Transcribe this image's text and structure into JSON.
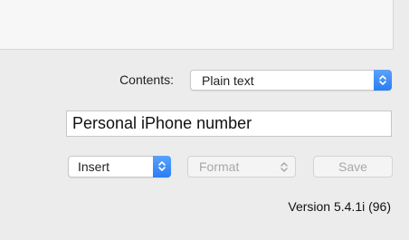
{
  "contents": {
    "label": "Contents:",
    "selected": "Plain text",
    "stepper_icon": "chevron-up-down-icon"
  },
  "text_field": {
    "value": "Personal iPhone number"
  },
  "insert": {
    "selected": "Insert",
    "stepper_icon": "chevron-up-down-icon"
  },
  "format": {
    "selected": "Format",
    "stepper_icon": "chevron-up-down-icon",
    "enabled": false
  },
  "save_button": {
    "label": "Save",
    "enabled": false
  },
  "version": "Version 5.4.1i (96)",
  "colors": {
    "accent": "#2a7ef2",
    "disabled_text": "#a8a8a8",
    "window_bg": "#ececec"
  }
}
